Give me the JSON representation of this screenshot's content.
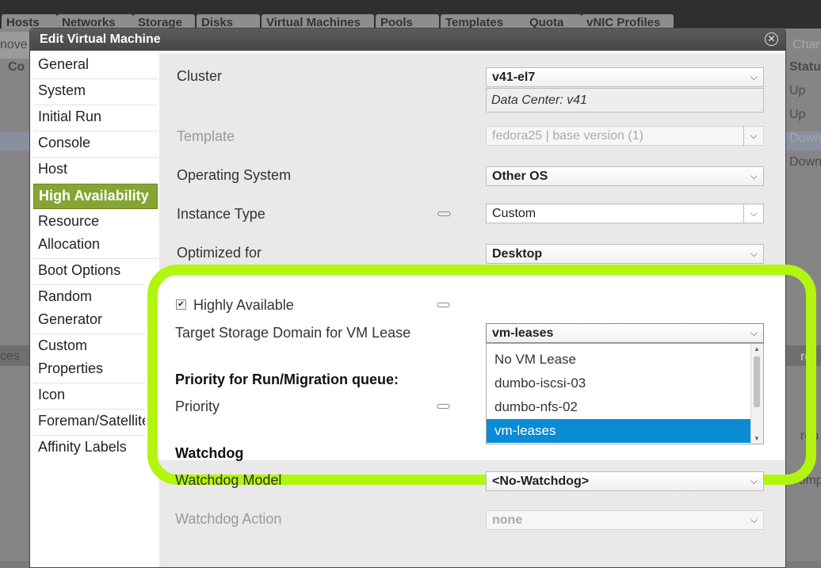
{
  "background": {
    "top_tabs": [
      "Hosts",
      "Networks",
      "Storage",
      "Disks",
      "Virtual Machines",
      "Pools",
      "Templates",
      "Quota",
      "vNIC Profiles"
    ],
    "left_fragments": [
      "nove",
      "Co",
      "ces"
    ],
    "right_fragments": [
      "Char",
      "Status",
      "Up",
      "Up",
      "Down",
      "Down",
      "ro",
      "rop",
      "Comp"
    ]
  },
  "dialog": {
    "title": "Edit Virtual Machine",
    "close_icon": "close-icon",
    "tabs": [
      {
        "label": "General"
      },
      {
        "label": "System"
      },
      {
        "label": "Initial Run"
      },
      {
        "label": "Console"
      },
      {
        "label": "Host"
      },
      {
        "label": "High Availability",
        "active": true
      },
      {
        "label": "Resource"
      },
      {
        "label": "Allocation"
      },
      {
        "label": "Boot Options"
      },
      {
        "label": "Random"
      },
      {
        "label": "Generator"
      },
      {
        "label": "Custom"
      },
      {
        "label": "Properties"
      },
      {
        "label": "Icon"
      },
      {
        "label": "Foreman/Satellite"
      },
      {
        "label": "Affinity Labels"
      }
    ],
    "active_tab_color": "#86a533"
  },
  "form": {
    "cluster_label": "Cluster",
    "cluster_value": "v41-el7",
    "data_center": "Data Center: v41",
    "template_label": "Template",
    "template_value": "fedora25 | base version (1)",
    "os_label": "Operating System",
    "os_value": "Other OS",
    "instance_type_label": "Instance Type",
    "instance_type_value": "Custom",
    "optimized_label": "Optimized for",
    "optimized_value": "Desktop",
    "highly_available_label": "Highly Available",
    "highly_available_checked": true,
    "target_storage_label": "Target Storage Domain for VM Lease",
    "target_storage_value": "vm-leases",
    "dropdown_options": [
      "No VM Lease",
      "dumbo-iscsi-03",
      "dumbo-nfs-02",
      "vm-leases"
    ],
    "dropdown_selected": "vm-leases",
    "priority_section": "Priority for Run/Migration queue:",
    "priority_label": "Priority",
    "watchdog_section": "Watchdog",
    "watchdog_model_label": "Watchdog Model",
    "watchdog_model_value": "<No-Watchdog>",
    "watchdog_action_label": "Watchdog Action",
    "watchdog_action_value": "none",
    "highlight_color": "#b2f60f",
    "selection_color": "#0a8bd6"
  }
}
